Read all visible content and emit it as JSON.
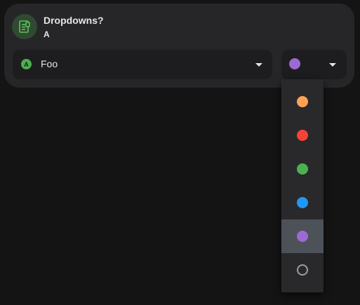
{
  "card": {
    "title": "Dropdowns?",
    "subtitle": "A",
    "icon": "receipt-icon"
  },
  "select_main": {
    "badge": "A",
    "badge_color": "#4caf50",
    "label": "Foo"
  },
  "select_color": {
    "selected_color": "#9c6ad2"
  },
  "color_menu": {
    "options": [
      {
        "color": "#ffa254",
        "selected": false
      },
      {
        "color": "#f44336",
        "selected": false
      },
      {
        "color": "#4caf50",
        "selected": false
      },
      {
        "color": "#2196f3",
        "selected": false
      },
      {
        "color": "#9c6ad2",
        "selected": true
      },
      {
        "color": "none",
        "selected": false
      }
    ]
  }
}
